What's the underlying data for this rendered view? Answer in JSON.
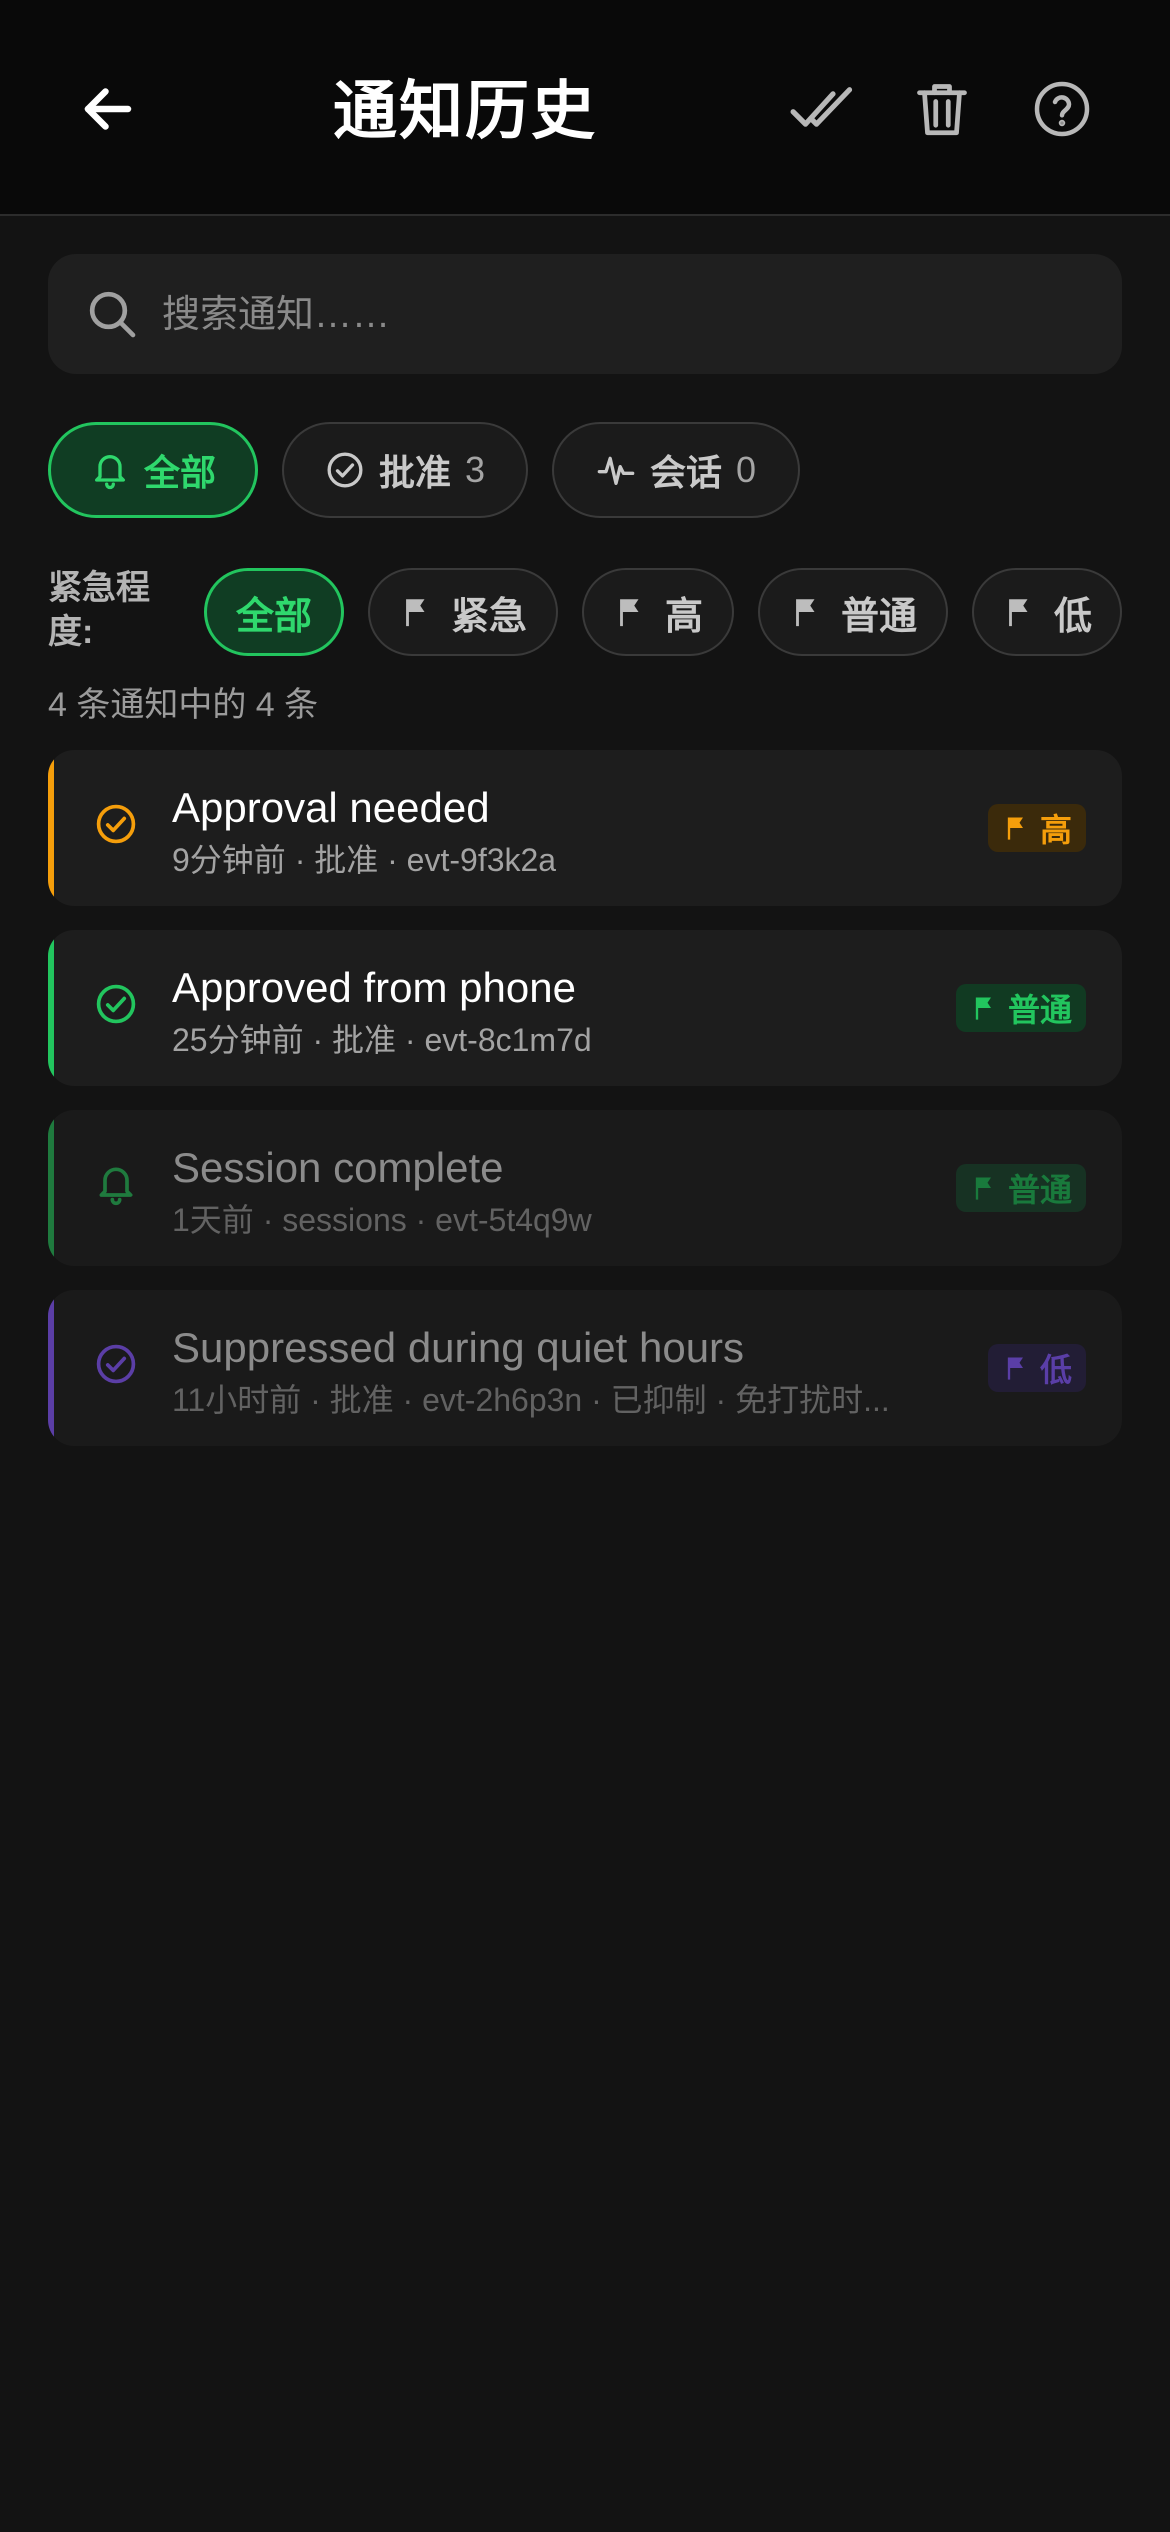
{
  "header": {
    "title": "通知历史",
    "back_icon": "arrow-left-icon",
    "actions": [
      "double-check-icon",
      "trash-icon",
      "help-circle-icon"
    ]
  },
  "search": {
    "placeholder": "搜索通知……",
    "value": ""
  },
  "type_filters": [
    {
      "label": "全部",
      "count": "",
      "icon": "bell-icon",
      "active": true
    },
    {
      "label": "批准",
      "count": "3",
      "icon": "check-circle-icon",
      "active": false
    },
    {
      "label": "会话",
      "count": "0",
      "icon": "activity-icon",
      "active": false
    }
  ],
  "urgency": {
    "label": "紧急程度:",
    "options": [
      {
        "label": "全部",
        "active": true
      },
      {
        "label": "紧急",
        "active": false
      },
      {
        "label": "高",
        "active": false
      },
      {
        "label": "普通",
        "active": false
      },
      {
        "label": "低",
        "active": false
      }
    ]
  },
  "result_count": "4 条通知中的 4 条",
  "colors": {
    "accent_green": "#22c55e",
    "high": "#f59e0b",
    "normal": "#22c55e",
    "low": "#7c4dda"
  },
  "notifications": [
    {
      "title": "Approval needed",
      "meta": "9分钟前 · 批准 · evt-9f3k2a",
      "urgency": "高",
      "icon": "check-circle-icon",
      "color": "#f59e0b",
      "read": false
    },
    {
      "title": "Approved from phone",
      "meta": "25分钟前 · 批准 · evt-8c1m7d",
      "urgency": "普通",
      "icon": "check-circle-icon",
      "color": "#22c55e",
      "read": false
    },
    {
      "title": "Session complete",
      "meta": "1天前 · sessions · evt-5t4q9w",
      "urgency": "普通",
      "icon": "bell-icon",
      "color": "#1f7a3e",
      "read": true
    },
    {
      "title": "Suppressed during quiet hours",
      "meta": "11小时前 · 批准 · evt-2h6p3n · 已抑制 · 免打扰时...",
      "urgency": "低",
      "icon": "check-circle-icon",
      "color": "#5b3ea6",
      "read": true
    }
  ]
}
